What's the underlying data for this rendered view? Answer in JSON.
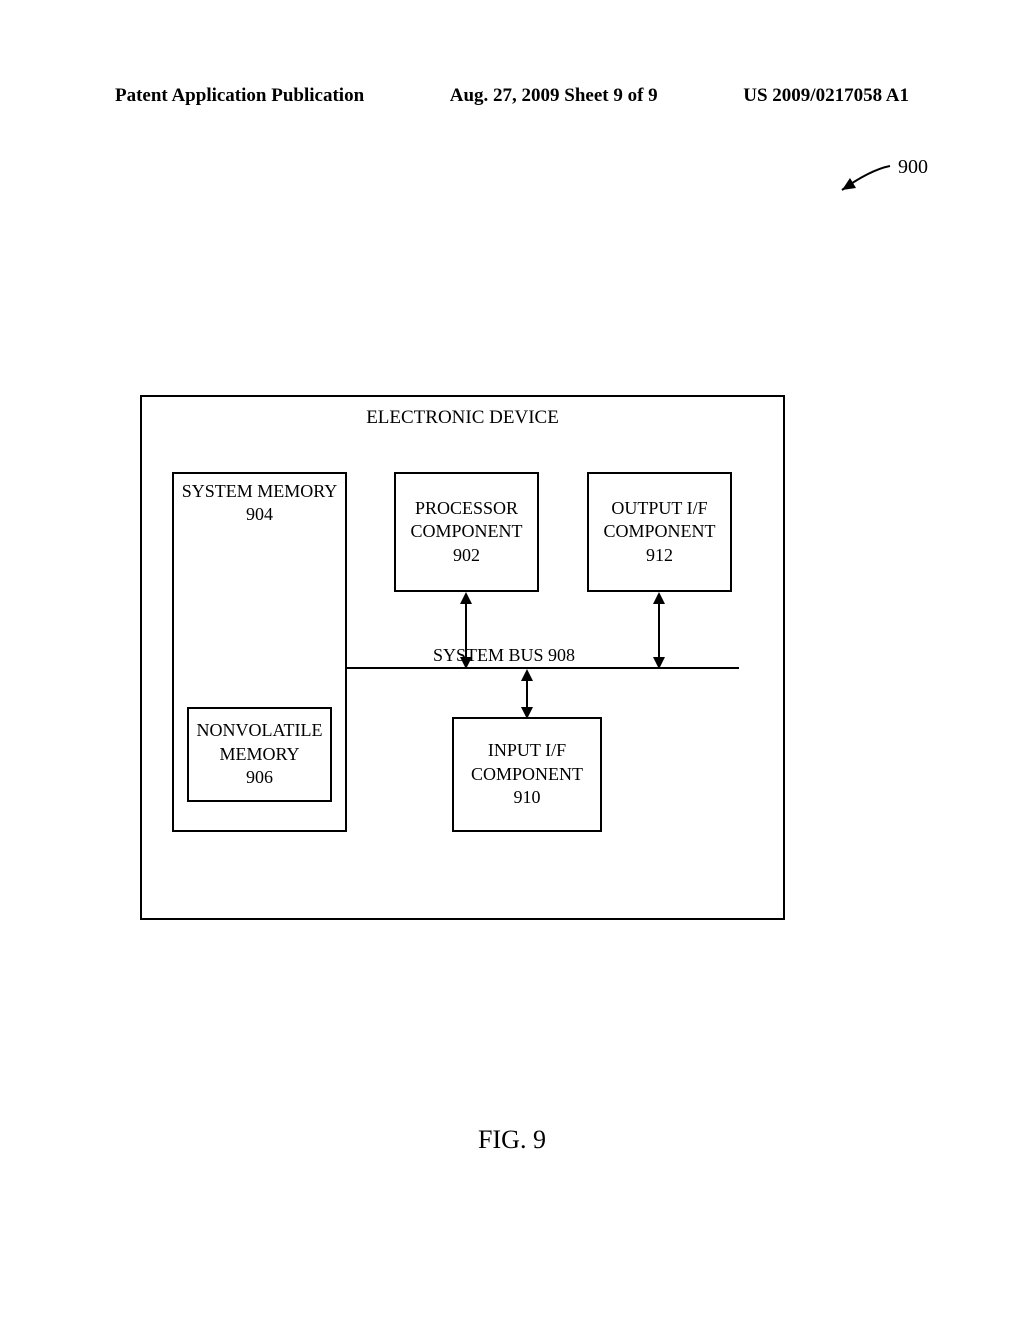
{
  "header": {
    "left": "Patent Application Publication",
    "mid": "Aug. 27, 2009  Sheet 9 of 9",
    "right": "US 2009/0217058 A1"
  },
  "ref_number": "900",
  "diagram": {
    "title": "ELECTRONIC DEVICE",
    "sysmem": {
      "line1": "SYSTEM MEMORY",
      "num": "904"
    },
    "nvmem": {
      "line1": "NONVOLATILE",
      "line2": "MEMORY",
      "num": "906"
    },
    "proc": {
      "line1": "PROCESSOR",
      "line2": "COMPONENT",
      "num": "902"
    },
    "outif": {
      "line1": "OUTPUT I/F",
      "line2": "COMPONENT",
      "num": "912"
    },
    "inif": {
      "line1": "INPUT I/F",
      "line2": "COMPONENT",
      "num": "910"
    },
    "bus_label": "SYSTEM BUS 908"
  },
  "figure_label": "FIG. 9"
}
